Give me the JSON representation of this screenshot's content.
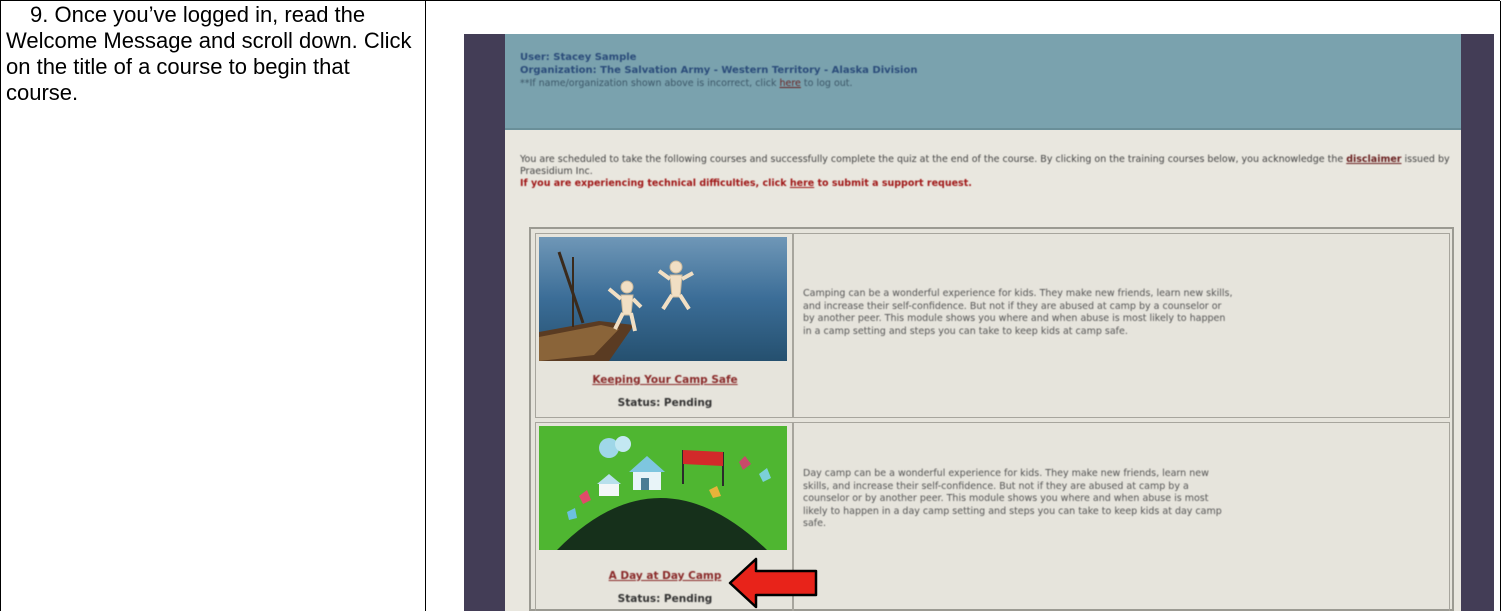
{
  "instruction": {
    "step_number": "9.",
    "text": "Once you’ve logged in, read the Welcome Message and scroll down. Click on the title of a course to begin that course."
  },
  "screenshot": {
    "header": {
      "user_label": "User: Stacey Sample",
      "organization_label": "Organization: The Salvation Army - Western Territory - Alaska Division",
      "note_before": "**If name/organization shown above is incorrect, click ",
      "note_link": "here",
      "note_after": " to log out."
    },
    "intro": {
      "line_1": "You are scheduled to take the following courses and successfully complete the quiz at the end of the course.  By clicking on the training courses below, you acknowledge the ",
      "disclaimer_link": "disclaimer",
      "line_1_end": " issued by Praesidium Inc.",
      "warning_before": "If you are experiencing technical difficulties, click ",
      "warning_link": "here",
      "warning_after": " to submit a support request."
    },
    "courses": [
      {
        "title": "Keeping Your Camp Safe",
        "status": "Status: Pending",
        "description": "Camping can be a wonderful experience for kids. They make new friends, learn new skills, and increase their self-confidence. But not if they are abused at camp by a counselor or by another peer. This module shows you where and when abuse is most likely to happen in a camp setting and steps you can take to keep kids at camp safe."
      },
      {
        "title": "A Day at Day Camp",
        "status": "Status: Pending",
        "description": "Day camp can be a wonderful experience for kids. They make new friends, learn new skills, and increase their self-confidence. But not if they are abused at camp by a counselor or by another peer. This module shows you where and when abuse is most likely to happen in a day camp setting and steps you can take to keep kids at day camp safe."
      }
    ]
  },
  "colors": {
    "arrow_fill": "#e8231a",
    "header_background": "#7aa2ae",
    "frame_background": "#433d56"
  },
  "icons": {
    "pointer": "left-arrow-icon"
  }
}
